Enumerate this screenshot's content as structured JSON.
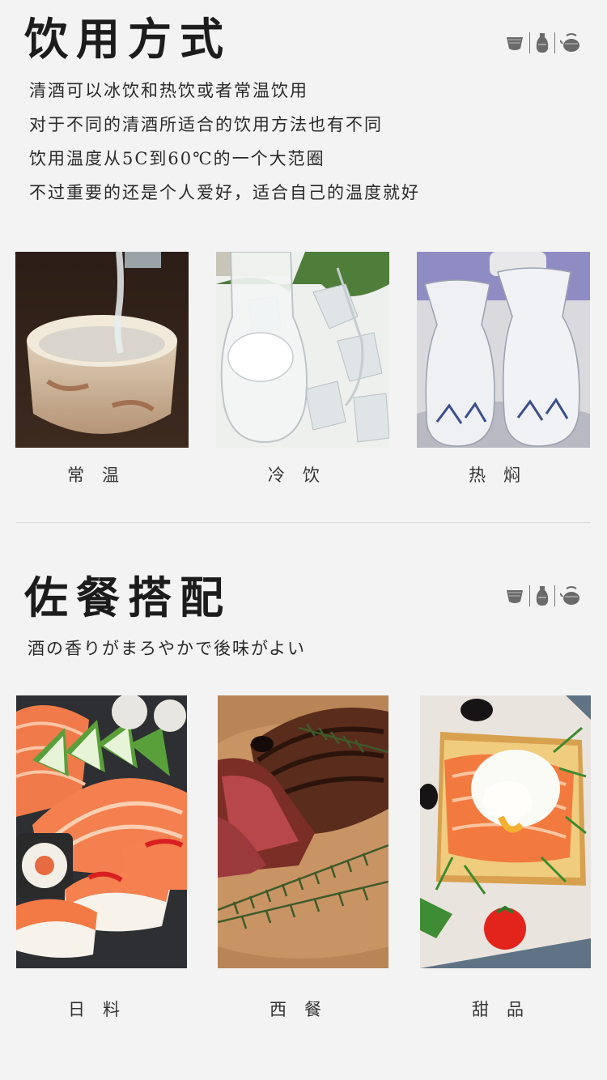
{
  "drinking": {
    "title": "饮用方式",
    "lines": [
      "清酒可以冰饮和热饮或者常温饮用",
      "对于不同的清酒所适合的饮用方法也有不同",
      "饮用温度从5C到60℃的一个大范圈",
      "不过重要的还是个人爱好，适合自己的温度就好"
    ],
    "captions": [
      "常温",
      "冷饮",
      "热焖"
    ],
    "icons": [
      "sake-cup-icon",
      "sake-bottle-icon",
      "teapot-icon"
    ]
  },
  "pairing": {
    "title": "佐餐搭配",
    "subtitle": "酒の香りがまろやかで後味がよい",
    "captions": [
      "日料",
      "西餐",
      "甜品"
    ],
    "icons": [
      "sake-cup-icon",
      "sake-bottle-icon",
      "teapot-icon"
    ]
  }
}
